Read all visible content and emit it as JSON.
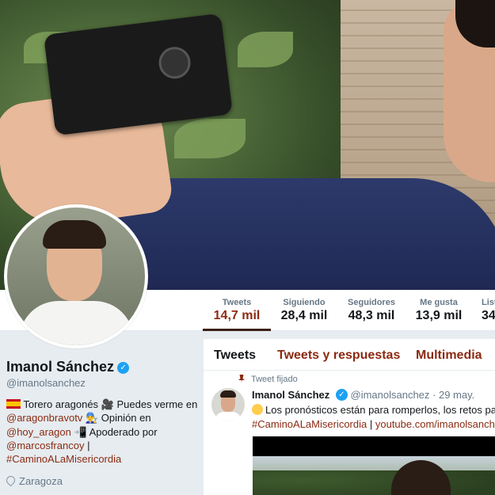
{
  "profile": {
    "name": "Imanol Sánchez",
    "handle": "@imanolsanchez",
    "bio_parts": {
      "p1": " Torero aragonés 🎥 Puedes verme en",
      "l1": "@aragonbravotv",
      "p2": " 👨‍🔧 Opinión en",
      "l2": "@hoy_aragon",
      "p3": " 📲 Apoderado por",
      "l3": "@marcosfrancoy",
      "p4": " |",
      "l4": "#CaminoALaMisericordia"
    },
    "location": "Zaragoza"
  },
  "stats": [
    {
      "label": "Tweets",
      "value": "14,7 mil"
    },
    {
      "label": "Siguiendo",
      "value": "28,4 mil"
    },
    {
      "label": "Seguidores",
      "value": "48,3 mil"
    },
    {
      "label": "Me gusta",
      "value": "13,9 mil"
    },
    {
      "label": "Listas",
      "value": "34"
    }
  ],
  "timeline": {
    "tabs": [
      "Tweets",
      "Tweets y respuestas",
      "Multimedia"
    ],
    "pinned_label": "Tweet fijado",
    "tweet": {
      "name": "Imanol Sánchez",
      "handle": "@imanolsanchez",
      "date": "· 29 may.",
      "text": "Los pronósticos están para romperlos, los retos para s",
      "hashtag": "#CaminoALaMisericordia",
      "separator": " | ",
      "link": "youtube.com/imanolsanchez"
    }
  },
  "colors": {
    "accent": "#8b2a12",
    "verified": "#1da1f2",
    "background": "#e6ecf0"
  },
  "icons": [
    "verified-icon",
    "flag-spain-icon",
    "location-pin-icon",
    "pin-icon",
    "fearful-face-emoji-icon"
  ]
}
